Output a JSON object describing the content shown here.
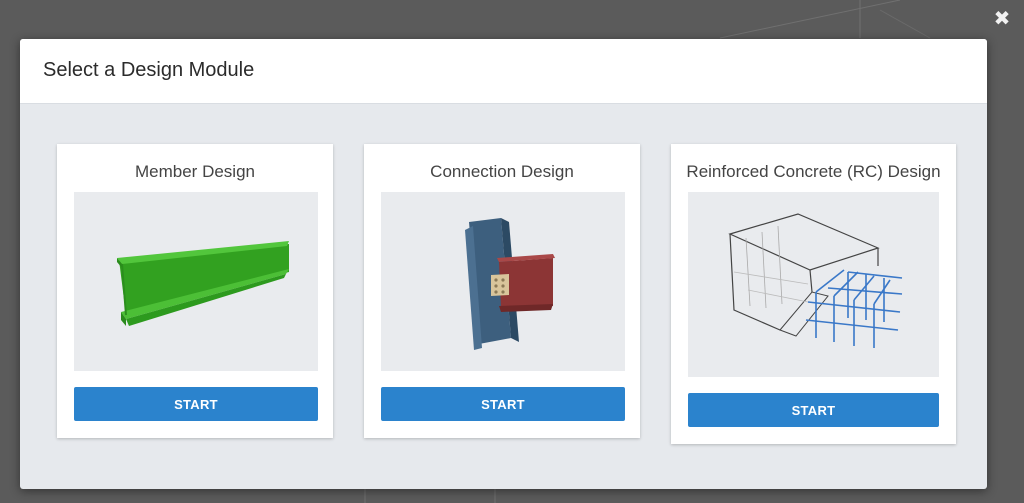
{
  "modal": {
    "title": "Select a Design Module",
    "close_icon": "close-x-icon"
  },
  "modules": [
    {
      "title": "Member Design",
      "button_label": "START",
      "image": "steel-i-beam-image"
    },
    {
      "title": "Connection Design",
      "button_label": "START",
      "image": "steel-connection-image"
    },
    {
      "title": "Reinforced Concrete (RC) Design",
      "button_label": "START",
      "image": "rc-reinforcement-cage-image"
    }
  ],
  "colors": {
    "primary_button": "#2b83cd",
    "beam_green": "#3db02a",
    "column_blue": "#3d5f7e",
    "beam_red": "#8c3535",
    "plate_tan": "#d9c59b",
    "rebar_blue": "#3a78c8"
  }
}
